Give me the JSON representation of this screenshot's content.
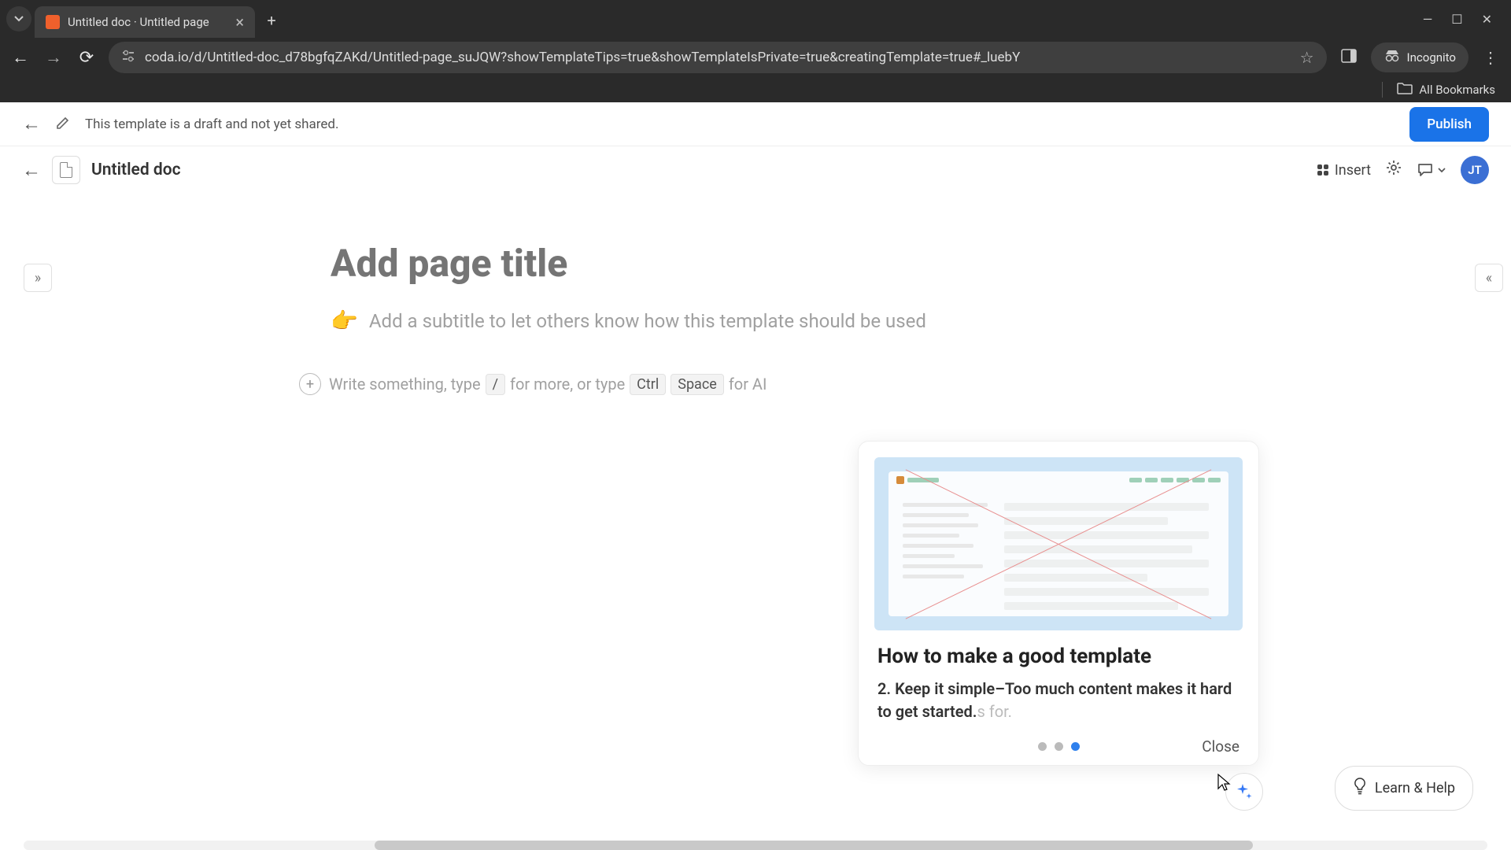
{
  "browser": {
    "tab_title": "Untitled doc · Untitled page",
    "url": "coda.io/d/Untitled-doc_d78bgfqZAKd/Untitled-page_suJQW?showTemplateTips=true&showTemplateIsPrivate=true&creatingTemplate=true#_luebY",
    "incognito_label": "Incognito",
    "all_bookmarks": "All Bookmarks"
  },
  "draft_bar": {
    "message": "This template is a draft and not yet shared.",
    "publish": "Publish"
  },
  "doc": {
    "title": "Untitled doc",
    "insert": "Insert",
    "avatar": "JT"
  },
  "content": {
    "title_placeholder": "Add page title",
    "subtitle_emoji": "👉",
    "subtitle": "Add a subtitle to let others know how this template should be used",
    "compose_pre": "Write something, type",
    "compose_slash": "/",
    "compose_mid": "for more, or type",
    "compose_ctrl": "Ctrl",
    "compose_space": "Space",
    "compose_post": "for AI"
  },
  "tip": {
    "title": "How to make a good template",
    "body_main": "2. Keep it simple–Too much content makes it hard to get started.",
    "body_faded": "s for.",
    "close": "Close",
    "active_dot": 2
  },
  "footer": {
    "learn_help": "Learn & Help"
  }
}
